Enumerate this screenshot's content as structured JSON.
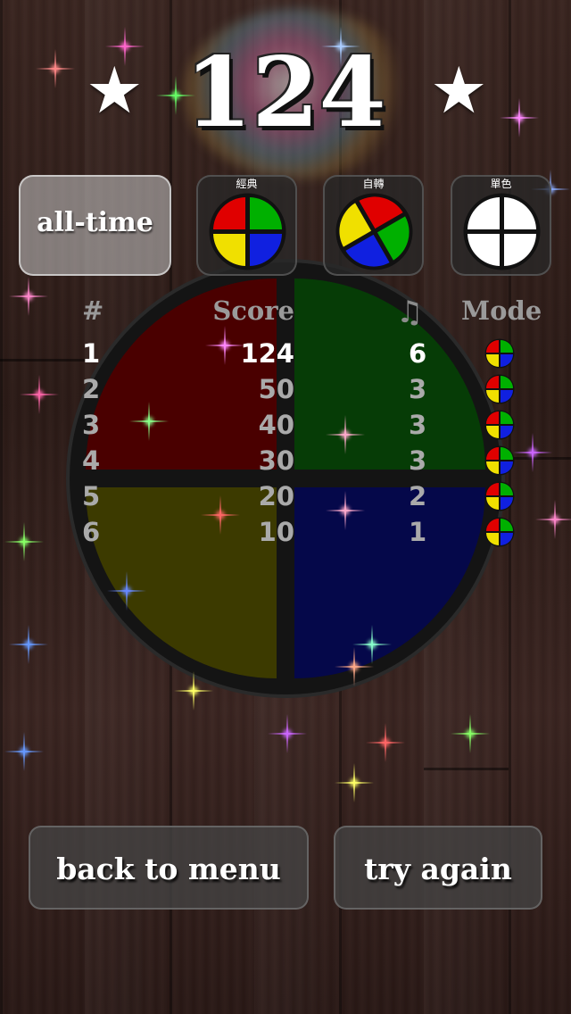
{
  "score": "124",
  "star_symbol": "★",
  "tabs": {
    "all_time": "all-time",
    "classic": "經典",
    "rotate": "自轉",
    "mono": "單色"
  },
  "table": {
    "headers": {
      "rank": "#",
      "score": "Score",
      "notes": "♫",
      "mode": "Mode"
    },
    "rows": [
      {
        "rank": "1",
        "score": "124",
        "notes": "6",
        "mode_icon": "classic-mode-icon"
      },
      {
        "rank": "2",
        "score": "50",
        "notes": "3",
        "mode_icon": "classic-mode-icon"
      },
      {
        "rank": "3",
        "score": "40",
        "notes": "3",
        "mode_icon": "classic-mode-icon"
      },
      {
        "rank": "4",
        "score": "30",
        "notes": "3",
        "mode_icon": "classic-mode-icon"
      },
      {
        "rank": "5",
        "score": "20",
        "notes": "2",
        "mode_icon": "classic-mode-icon"
      },
      {
        "rank": "6",
        "score": "10",
        "notes": "1",
        "mode_icon": "classic-mode-icon"
      }
    ]
  },
  "buttons": {
    "back": "back to menu",
    "retry": "try again"
  },
  "colors": {
    "red": "#e00000",
    "green": "#00b000",
    "yellow": "#f0e000",
    "blue": "#1020e0",
    "dim_red": "#4a0000",
    "dim_green": "#063c06",
    "dim_yellow": "#3c3a00",
    "dim_blue": "#05084a"
  }
}
